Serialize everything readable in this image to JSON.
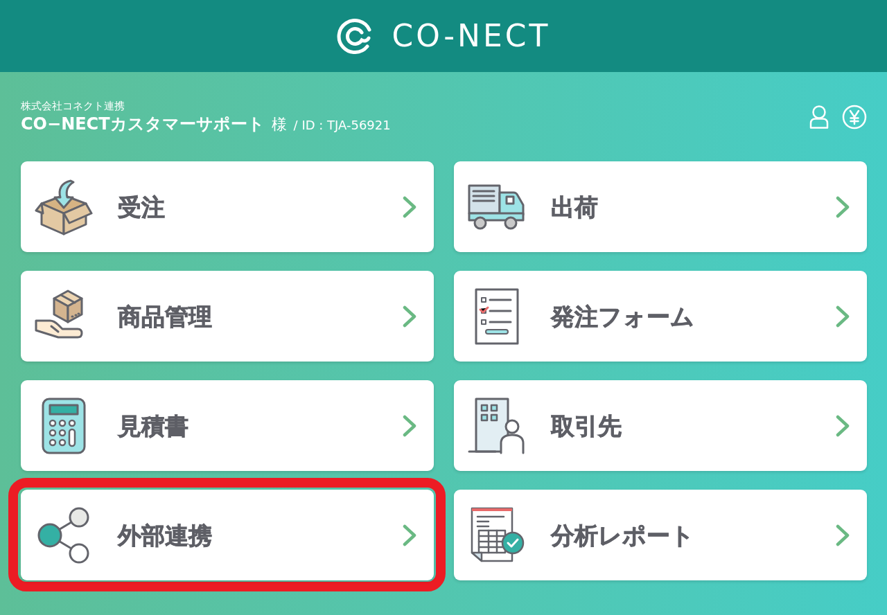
{
  "header": {
    "logo": "CO-NECT"
  },
  "account": {
    "company": "株式会社コネクト連携",
    "name": "CO−NECTカスタマーサポート",
    "honorific": "様",
    "id_label": "/ ID : TJA-56921"
  },
  "menu": [
    {
      "label": "受注",
      "kind": "receive",
      "highlighted": false
    },
    {
      "label": "出荷",
      "kind": "truck",
      "highlighted": false
    },
    {
      "label": "商品管理",
      "kind": "product",
      "highlighted": false
    },
    {
      "label": "発注フォーム",
      "kind": "form",
      "highlighted": false
    },
    {
      "label": "見積書",
      "kind": "calculator",
      "highlighted": false
    },
    {
      "label": "取引先",
      "kind": "partner",
      "highlighted": false
    },
    {
      "label": "外部連携",
      "kind": "share",
      "highlighted": true
    },
    {
      "label": "分析レポート",
      "kind": "report",
      "highlighted": false
    }
  ]
}
